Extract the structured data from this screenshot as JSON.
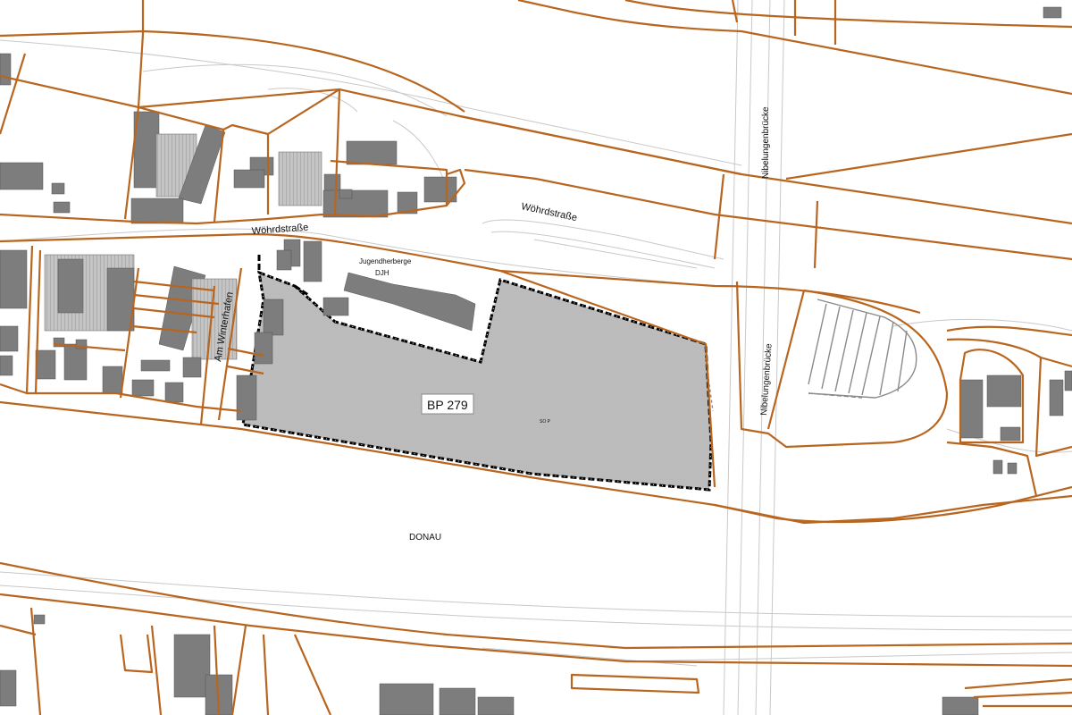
{
  "plan": {
    "id_label": "BP 279",
    "zone_label": "SO P"
  },
  "streets": {
    "woehrdstrasse_west": "Wöhrdstraße",
    "woehrdstrasse_east": "Wöhrdstraße",
    "nibelungenbruecke_north": "Nibelungenbrücke",
    "nibelungenbruecke_south": "Nibelungenbrücke",
    "am_winterhafen": "Am Winterhafen"
  },
  "places": {
    "jugendherberge": "Jugendherberge",
    "djh": "DJH",
    "river": "DONAU"
  },
  "colors": {
    "parcel_line": "#b8661f",
    "building": "#7d7d7d",
    "plan_area_fill": "#bdbdbd",
    "plan_boundary": "#000000"
  }
}
